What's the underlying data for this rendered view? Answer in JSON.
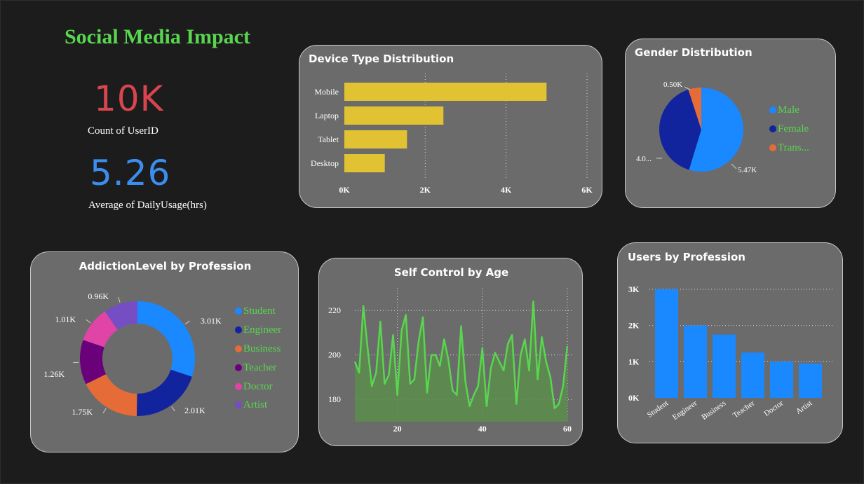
{
  "dashboard": {
    "title": "Social Media Impact",
    "kpis": [
      {
        "value": "10K",
        "label": "Count of UserID",
        "color": "#d9454f"
      },
      {
        "value": "5.26",
        "label": "Average of DailyUsage(hrs)",
        "color": "#3b8df0"
      }
    ]
  },
  "colors": {
    "background": "#1c1c1c",
    "card": "#6b6b6b",
    "title_green": "#59d64f",
    "bar_yellow": "#e1c232",
    "bar_blue": "#1a88ff",
    "line_green": "#59d64f"
  },
  "chart_data": [
    {
      "id": "device",
      "type": "bar",
      "orientation": "horizontal",
      "title": "Device Type Distribution",
      "categories": [
        "Mobile",
        "Laptop",
        "Tablet",
        "Desktop"
      ],
      "values": [
        5000,
        2450,
        1550,
        1000
      ],
      "xlim": [
        0,
        6000
      ],
      "xticks": [
        "0K",
        "2K",
        "4K",
        "6K"
      ],
      "grid": true
    },
    {
      "id": "gender",
      "type": "pie",
      "title": "Gender Distribution",
      "categories": [
        "Male",
        "Female",
        "Trans..."
      ],
      "values": [
        5470,
        4030,
        500
      ],
      "data_labels": [
        "5.47K",
        "4.0...",
        "0.50K"
      ],
      "legend": "right"
    },
    {
      "id": "addiction",
      "type": "pie",
      "donut": true,
      "title": "AddictionLevel by Profession",
      "categories": [
        "Student",
        "Engineer",
        "Business",
        "Teacher",
        "Doctor",
        "Artist"
      ],
      "values": [
        3010,
        2010,
        1750,
        1260,
        1010,
        960
      ],
      "data_labels": [
        "3.01K",
        "2.01K",
        "1.75K",
        "1.26K",
        "1.01K",
        "0.96K"
      ],
      "legend": "right"
    },
    {
      "id": "selfcontrol",
      "type": "area",
      "title": "Self Control by Age",
      "x": [
        10,
        11,
        12,
        13,
        14,
        15,
        16,
        17,
        18,
        19,
        20,
        21,
        22,
        23,
        24,
        25,
        26,
        27,
        28,
        29,
        30,
        31,
        32,
        33,
        34,
        35,
        36,
        37,
        38,
        39,
        40,
        41,
        42,
        43,
        44,
        45,
        46,
        47,
        48,
        49,
        50,
        51,
        52,
        53,
        54,
        55,
        56,
        57,
        58,
        59,
        60
      ],
      "values": [
        197,
        192,
        222,
        203,
        186,
        192,
        215,
        187,
        191,
        209,
        182,
        211,
        218,
        187,
        189,
        206,
        217,
        183,
        200,
        200,
        195,
        207,
        198,
        184,
        182,
        213,
        188,
        177,
        182,
        186,
        203,
        177,
        194,
        201,
        197,
        193,
        205,
        209,
        178,
        200,
        207,
        193,
        224,
        189,
        208,
        197,
        190,
        176,
        178,
        186,
        204
      ],
      "xlim": [
        10,
        60
      ],
      "ylim": [
        170,
        227
      ],
      "xticks": [
        20,
        40,
        60
      ],
      "yticks": [
        180,
        200,
        220
      ],
      "grid": true
    },
    {
      "id": "profession",
      "type": "bar",
      "title": "Users by Profession",
      "categories": [
        "Student",
        "Engineer",
        "Business",
        "Teacher",
        "Doctor",
        "Artist"
      ],
      "values": [
        3000,
        2000,
        1750,
        1250,
        1000,
        950
      ],
      "ylim": [
        0,
        3000
      ],
      "yticks": [
        "0K",
        "1K",
        "2K",
        "3K"
      ],
      "grid": true
    }
  ]
}
